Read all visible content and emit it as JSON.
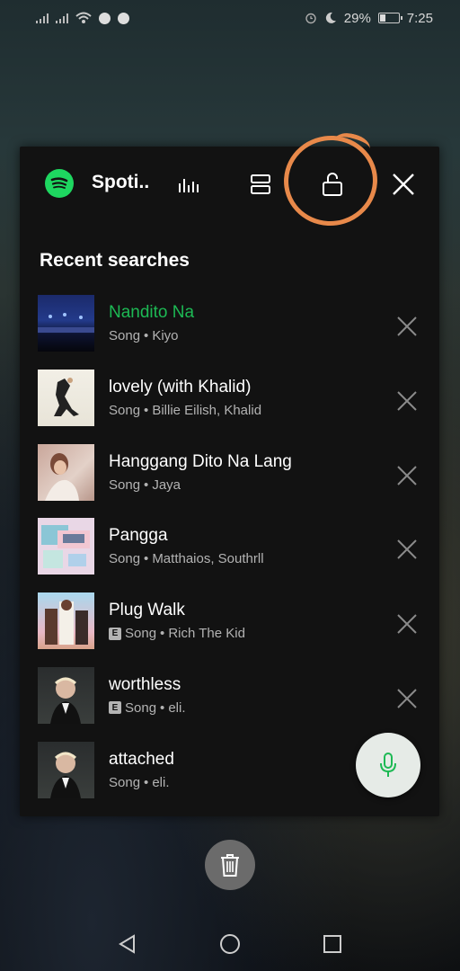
{
  "status_bar": {
    "battery": "29%",
    "time": "7:25"
  },
  "widget": {
    "app_name": "Spoti..",
    "section_title": "Recent searches",
    "icons": {
      "equalizer": "equalizer-icon",
      "layout": "split-view-icon",
      "lock": "unlock-icon",
      "close": "close-icon"
    },
    "annotation_color": "#e8894a",
    "accent": "#1db954",
    "items": [
      {
        "title": "Nandito Na",
        "type": "Song",
        "artist": "Kiyo",
        "explicit": false,
        "highlight": true
      },
      {
        "title": "lovely (with Khalid)",
        "type": "Song",
        "artist": "Billie Eilish, Khalid",
        "explicit": false,
        "highlight": false
      },
      {
        "title": "Hanggang Dito Na Lang",
        "type": "Song",
        "artist": "Jaya",
        "explicit": false,
        "highlight": false
      },
      {
        "title": "Pangga",
        "type": "Song",
        "artist": "Matthaios, Southrll",
        "explicit": false,
        "highlight": false
      },
      {
        "title": "Plug Walk",
        "type": "Song",
        "artist": "Rich The Kid",
        "explicit": true,
        "highlight": false
      },
      {
        "title": "worthless",
        "type": "Song",
        "artist": "eli.",
        "explicit": true,
        "highlight": false
      },
      {
        "title": "attached",
        "type": "Song",
        "artist": "eli.",
        "explicit": false,
        "highlight": false
      }
    ],
    "explicit_badge": "E",
    "separator": "•"
  }
}
